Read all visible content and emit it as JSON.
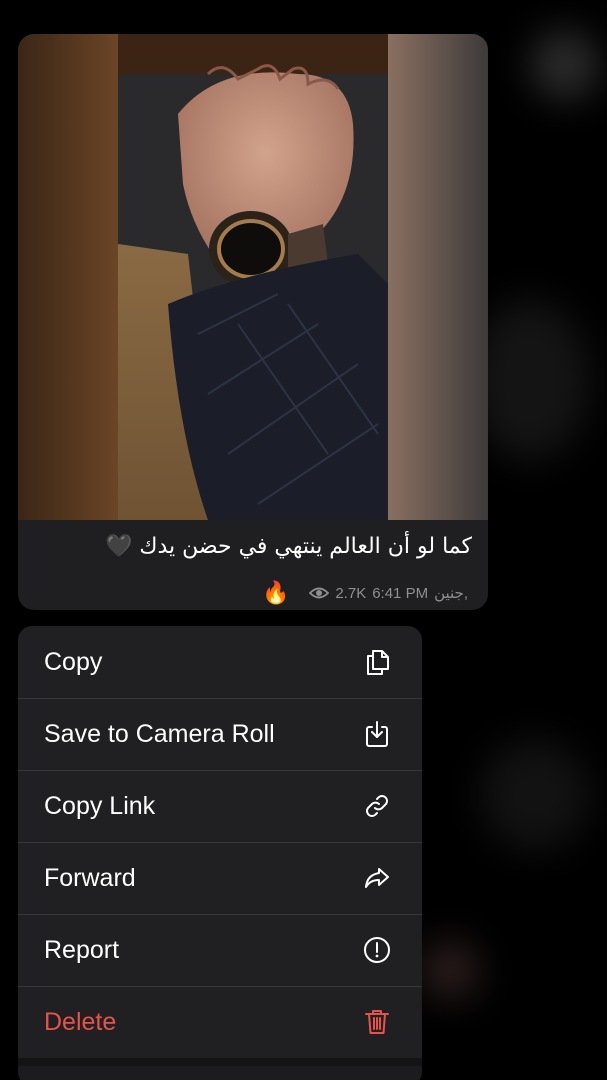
{
  "message": {
    "caption": "كما لو أن العالم ينتهي في حضن يدك",
    "caption_emoji": "🖤",
    "reaction_emoji": "🔥",
    "views": "2.7K",
    "author": "جنين,",
    "time": "6:41 PM"
  },
  "menu": {
    "items": [
      {
        "label": "Copy",
        "icon": "copy-icon"
      },
      {
        "label": "Save to Camera Roll",
        "icon": "download-icon"
      },
      {
        "label": "Copy Link",
        "icon": "link-icon"
      },
      {
        "label": "Forward",
        "icon": "forward-icon"
      },
      {
        "label": "Report",
        "icon": "report-icon"
      },
      {
        "label": "Delete",
        "icon": "trash-icon"
      }
    ]
  },
  "colors": {
    "danger": "#e5534b",
    "menu_bg": "#202022",
    "bubble_bg": "#1f1f21"
  }
}
